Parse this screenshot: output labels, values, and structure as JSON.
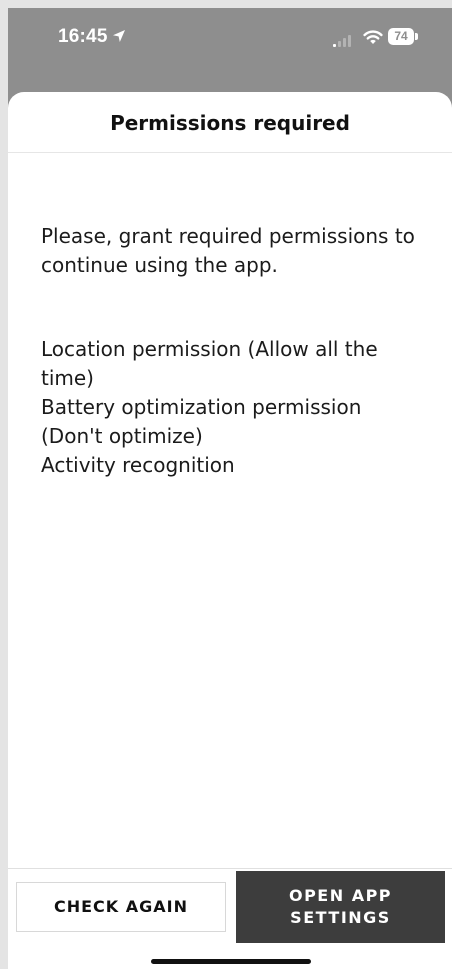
{
  "status_bar": {
    "time": "16:45",
    "battery_level": "74"
  },
  "dialog": {
    "title": "Permissions required",
    "intro": "Please, grant required permissions to continue using the app.",
    "permissions": [
      "Location permission (Allow all the time)",
      "Battery optimization permission (Don't optimize)",
      "Activity recognition"
    ]
  },
  "actions": {
    "check_again": "CHECK AGAIN",
    "open_app_settings_line1": "OPEN APP",
    "open_app_settings_line2": "SETTINGS"
  },
  "icons": {
    "location": "location-arrow-icon",
    "signal": "cellular-signal-icon",
    "wifi": "wifi-icon",
    "battery": "battery-icon"
  },
  "colors": {
    "status_background": "#8e8e8e",
    "sheet_background": "#ffffff",
    "primary_button": "#3d3d3d"
  }
}
